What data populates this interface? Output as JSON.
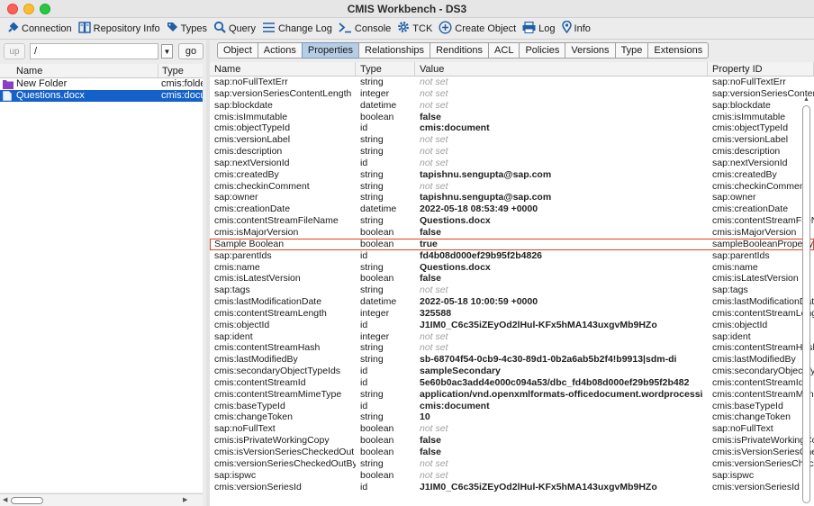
{
  "window": {
    "title": "CMIS Workbench - DS3"
  },
  "toolbar": {
    "connection": "Connection",
    "repository_info": "Repository Info",
    "types": "Types",
    "query": "Query",
    "change_log": "Change Log",
    "console": "Console",
    "tck": "TCK",
    "create_object": "Create Object",
    "log": "Log",
    "info": "Info"
  },
  "pathbar": {
    "up_label": "up",
    "path_value": "/",
    "go_label": "go"
  },
  "left_table": {
    "headers": {
      "name": "Name",
      "type": "Type"
    },
    "rows": [
      {
        "name": "New Folder",
        "type": "cmis:folder"
      },
      {
        "name": "Questions.docx",
        "type": "cmis:document"
      }
    ]
  },
  "tabs": [
    "Object",
    "Actions",
    "Properties",
    "Relationships",
    "Renditions",
    "ACL",
    "Policies",
    "Versions",
    "Type",
    "Extensions"
  ],
  "properties": {
    "headers": {
      "name": "Name",
      "type": "Type",
      "value": "Value",
      "id": "Property ID"
    },
    "rows": [
      {
        "name": "sap:noFullTextErr",
        "type": "string",
        "value": "not set",
        "id": "sap:noFullTextErr"
      },
      {
        "name": "sap:versionSeriesContentLength",
        "type": "integer",
        "value": "not set",
        "id": "sap:versionSeriesContentLength"
      },
      {
        "name": "sap:blockdate",
        "type": "datetime",
        "value": "not set",
        "id": "sap:blockdate"
      },
      {
        "name": "cmis:isImmutable",
        "type": "boolean",
        "value": "false",
        "id": "cmis:isImmutable"
      },
      {
        "name": "cmis:objectTypeId",
        "type": "id",
        "value": "cmis:document",
        "id": "cmis:objectTypeId"
      },
      {
        "name": "cmis:versionLabel",
        "type": "string",
        "value": "not set",
        "id": "cmis:versionLabel"
      },
      {
        "name": "cmis:description",
        "type": "string",
        "value": "not set",
        "id": "cmis:description"
      },
      {
        "name": "sap:nextVersionId",
        "type": "id",
        "value": "not set",
        "id": "sap:nextVersionId"
      },
      {
        "name": "cmis:createdBy",
        "type": "string",
        "value": "tapishnu.sengupta@sap.com",
        "id": "cmis:createdBy"
      },
      {
        "name": "cmis:checkinComment",
        "type": "string",
        "value": "not set",
        "id": "cmis:checkinComment"
      },
      {
        "name": "sap:owner",
        "type": "string",
        "value": "tapishnu.sengupta@sap.com",
        "id": "sap:owner"
      },
      {
        "name": "cmis:creationDate",
        "type": "datetime",
        "value": "2022-05-18 08:53:49 +0000",
        "id": "cmis:creationDate"
      },
      {
        "name": "cmis:contentStreamFileName",
        "type": "string",
        "value": "Questions.docx",
        "id": "cmis:contentStreamFileName"
      },
      {
        "name": "cmis:isMajorVersion",
        "type": "boolean",
        "value": "false",
        "id": "cmis:isMajorVersion"
      },
      {
        "name": "Sample Boolean",
        "type": "boolean",
        "value": "true",
        "id": "sampleBooleanProperty",
        "highlight": true
      },
      {
        "name": "sap:parentIds",
        "type": "id",
        "value": "fd4b08d000ef29b95f2b4826",
        "id": "sap:parentIds"
      },
      {
        "name": "cmis:name",
        "type": "string",
        "value": "Questions.docx",
        "id": "cmis:name"
      },
      {
        "name": "cmis:isLatestVersion",
        "type": "boolean",
        "value": "false",
        "id": "cmis:isLatestVersion"
      },
      {
        "name": "sap:tags",
        "type": "string",
        "value": "not set",
        "id": "sap:tags"
      },
      {
        "name": "cmis:lastModificationDate",
        "type": "datetime",
        "value": "2022-05-18 10:00:59 +0000",
        "id": "cmis:lastModificationDate"
      },
      {
        "name": "cmis:contentStreamLength",
        "type": "integer",
        "value": "325588",
        "id": "cmis:contentStreamLength"
      },
      {
        "name": "cmis:objectId",
        "type": "id",
        "value": "J1IM0_C6c35iZEyOd2lHul-KFx5hMA143uxgvMb9HZo",
        "id": "cmis:objectId"
      },
      {
        "name": "sap:ident",
        "type": "integer",
        "value": "not set",
        "id": "sap:ident"
      },
      {
        "name": "cmis:contentStreamHash",
        "type": "string",
        "value": "not set",
        "id": "cmis:contentStreamHash"
      },
      {
        "name": "cmis:lastModifiedBy",
        "type": "string",
        "value": "sb-68704f54-0cb9-4c30-89d1-0b2a6ab5b2f4!b9913|sdm-di",
        "id": "cmis:lastModifiedBy"
      },
      {
        "name": "cmis:secondaryObjectTypeIds",
        "type": "id",
        "value": "sampleSecondary",
        "id": "cmis:secondaryObjectTypeIds"
      },
      {
        "name": "cmis:contentStreamId",
        "type": "id",
        "value": "5e60b0ac3add4e000c094a53/dbc_fd4b08d000ef29b95f2b482",
        "id": "cmis:contentStreamId"
      },
      {
        "name": "cmis:contentStreamMimeType",
        "type": "string",
        "value": "application/vnd.openxmlformats-officedocument.wordprocessi",
        "id": "cmis:contentStreamMimeType"
      },
      {
        "name": "cmis:baseTypeId",
        "type": "id",
        "value": "cmis:document",
        "id": "cmis:baseTypeId"
      },
      {
        "name": "cmis:changeToken",
        "type": "string",
        "value": "10",
        "id": "cmis:changeToken"
      },
      {
        "name": "sap:noFullText",
        "type": "boolean",
        "value": "not set",
        "id": "sap:noFullText"
      },
      {
        "name": "cmis:isPrivateWorkingCopy",
        "type": "boolean",
        "value": "false",
        "id": "cmis:isPrivateWorkingCopy"
      },
      {
        "name": "cmis:isVersionSeriesCheckedOut",
        "type": "boolean",
        "value": "false",
        "id": "cmis:isVersionSeriesCheckedOut"
      },
      {
        "name": "cmis:versionSeriesCheckedOutBy",
        "type": "string",
        "value": "not set",
        "id": "cmis:versionSeriesCheckedOutBy"
      },
      {
        "name": "sap:ispwc",
        "type": "boolean",
        "value": "not set",
        "id": "sap:ispwc"
      },
      {
        "name": "cmis:versionSeriesId",
        "type": "id",
        "value": "J1IM0_C6c35iZEyOd2lHul-KFx5hMA143uxgvMb9HZo",
        "id": "cmis:versionSeriesId"
      }
    ]
  },
  "icons": {
    "connection": "plug-icon",
    "repository_info": "book-icon",
    "types": "tag-icon",
    "query": "magnifier-icon",
    "change_log": "list-icon",
    "console": "terminal-icon",
    "tck": "gear-icon",
    "create_object": "plus-circle-icon",
    "log": "printer-icon",
    "info": "pin-icon"
  },
  "colors": {
    "selection": "#1361c9",
    "highlight_border": "#e3411c",
    "active_tab": "#b6cde6",
    "accent_icon": "#1f5fa8"
  }
}
